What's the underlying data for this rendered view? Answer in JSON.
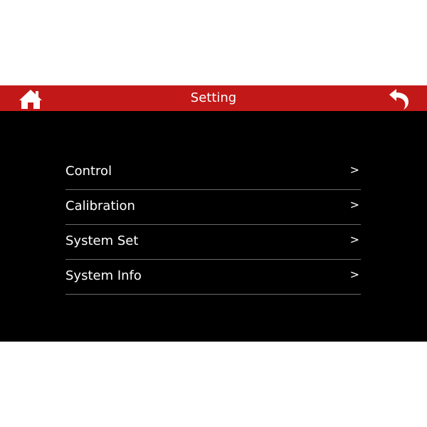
{
  "header": {
    "title": "Setting",
    "home_icon": "home-icon",
    "back_icon": "back-arrow-icon"
  },
  "menu": {
    "items": [
      {
        "label": "Control",
        "chevron": ">"
      },
      {
        "label": "Calibration",
        "chevron": ">"
      },
      {
        "label": "System Set",
        "chevron": ">"
      },
      {
        "label": "System Info",
        "chevron": ">"
      }
    ]
  },
  "colors": {
    "header_bg": "#c31818",
    "screen_bg": "#000000",
    "text": "#ffffff",
    "divider": "#6a6a6a"
  }
}
